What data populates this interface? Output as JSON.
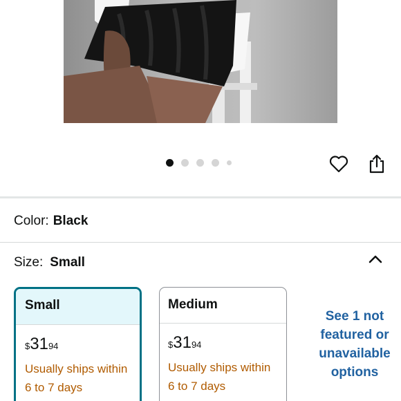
{
  "carousel": {
    "total_dots": 5,
    "active_index": 0
  },
  "actions": {
    "favorite_icon": "heart-outline-icon",
    "share_icon": "share-icon"
  },
  "color": {
    "label": "Color:",
    "value": "Black"
  },
  "size": {
    "label": "Size:",
    "value": "Small",
    "toggle_icon": "chevron-up-icon"
  },
  "size_options": [
    {
      "name": "Small",
      "price_symbol": "$",
      "price_whole": "31",
      "price_fraction": "94",
      "shipping_line1": "Usually ships within",
      "shipping_line2": "6 to 7 days",
      "selected": true
    },
    {
      "name": "Medium",
      "price_symbol": "$",
      "price_whole": "31",
      "price_fraction": "94",
      "shipping_line1": "Usually ships within",
      "shipping_line2": "6 to 7 days",
      "selected": false
    }
  ],
  "see_more": {
    "line1": "See 1 not",
    "line2": "featured or",
    "line3": "unavailable",
    "line4": "options"
  },
  "colors": {
    "accent": "#007185",
    "selected_bg": "#e3f7fb",
    "link": "#2162a1",
    "shipping": "#b05b00"
  }
}
